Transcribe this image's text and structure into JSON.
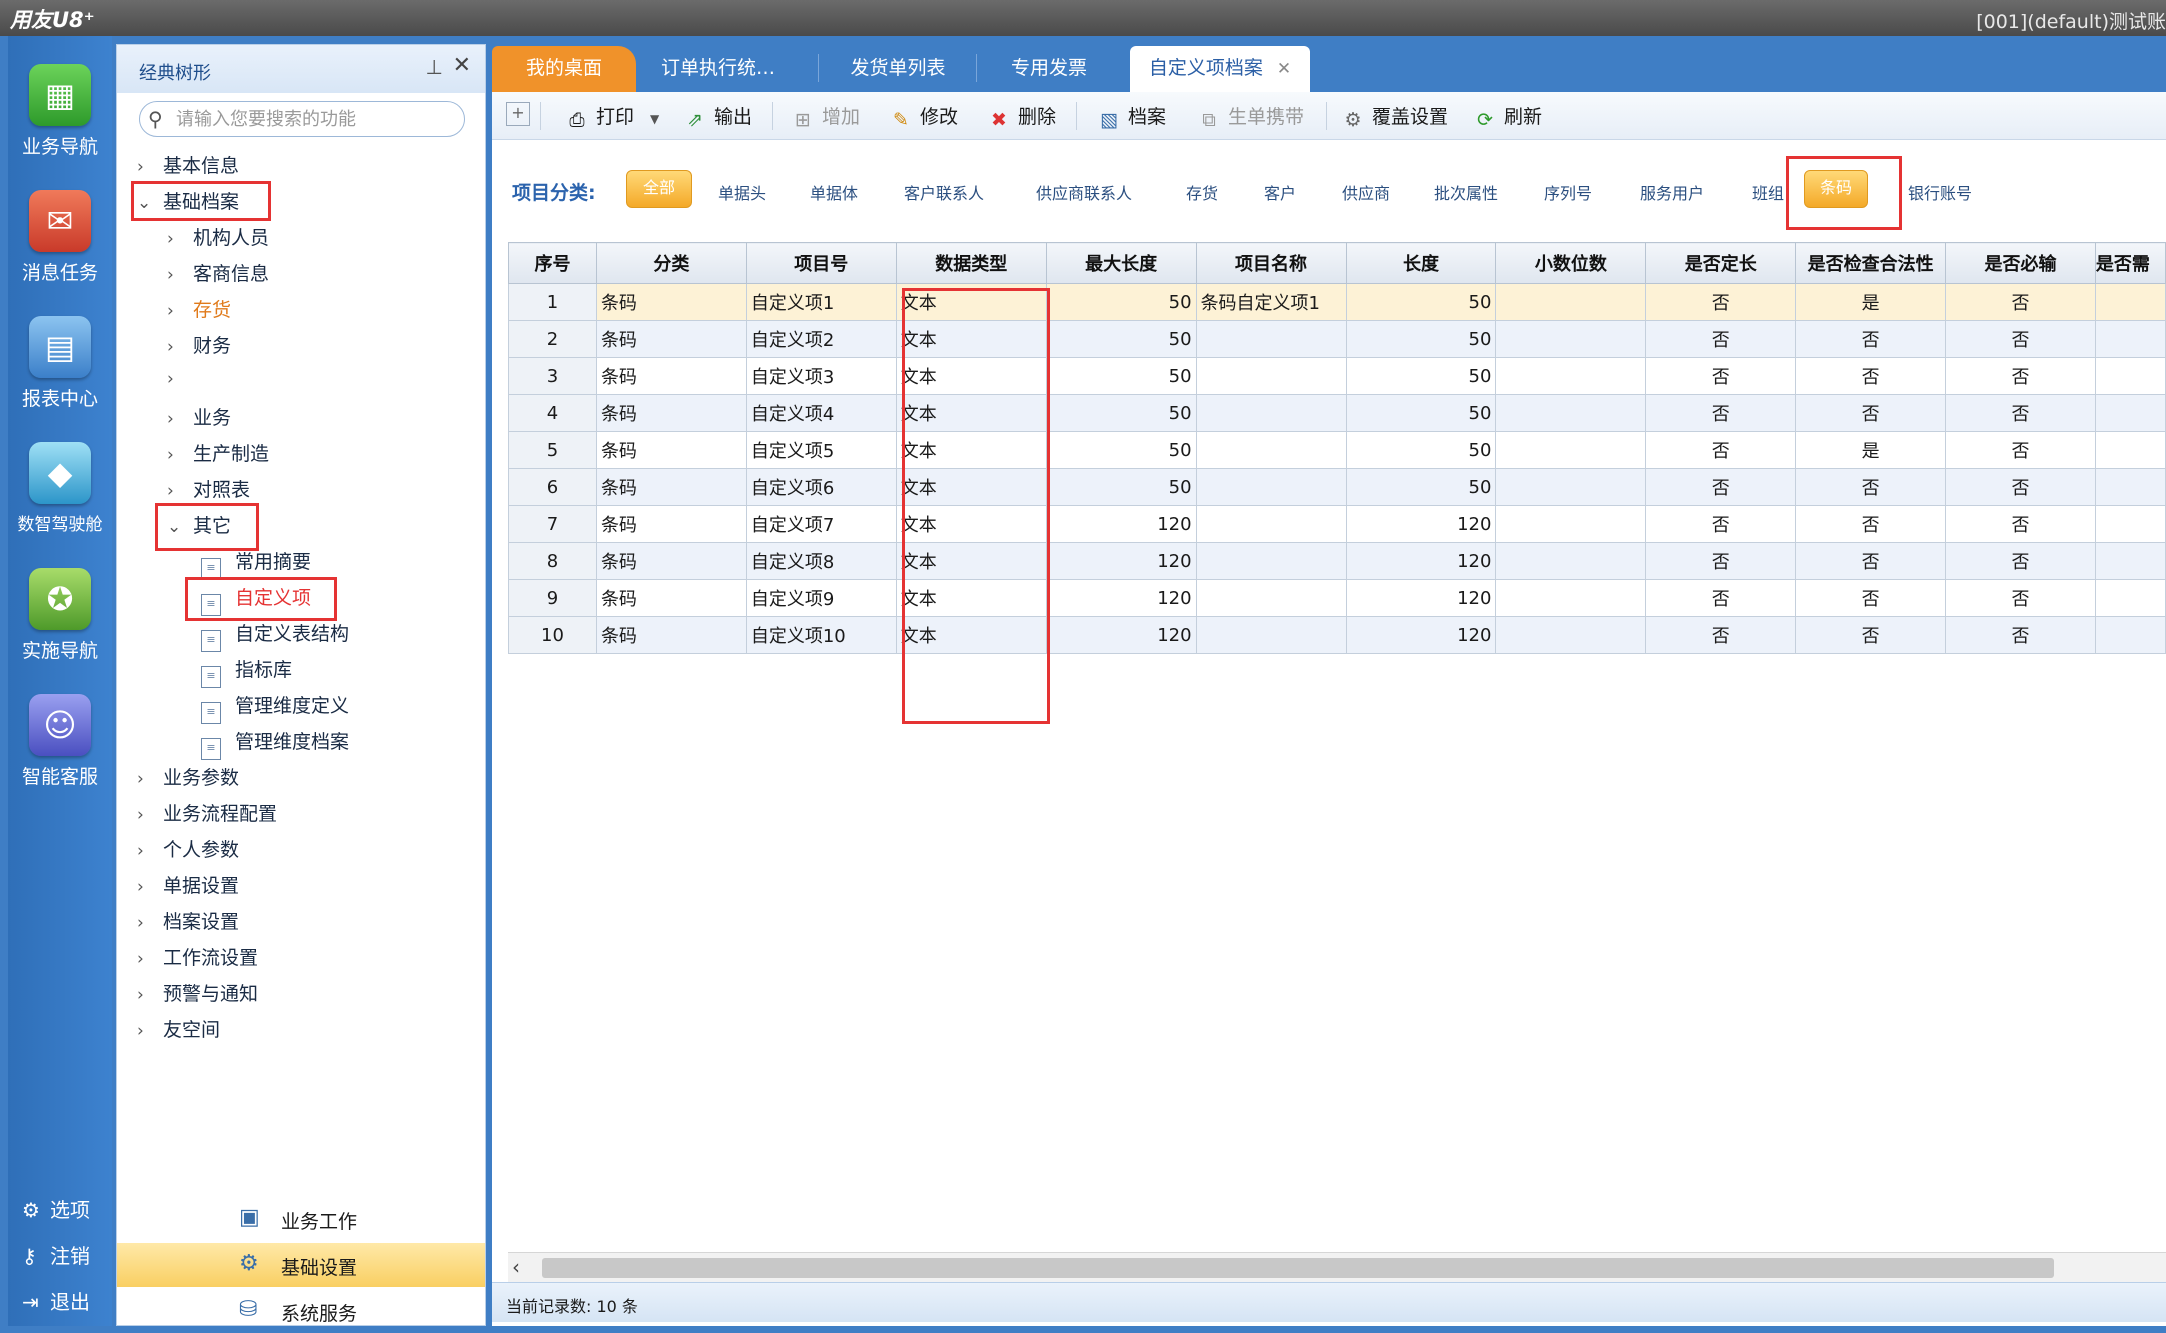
{
  "app": {
    "title": "用友U8⁺",
    "account": "[001](default)测试账"
  },
  "rail": {
    "items": [
      {
        "label": "业务导航",
        "icon": "business-nav-icon",
        "color": "#3fae3a"
      },
      {
        "label": "消息任务",
        "icon": "message-task-icon",
        "color": "#d94b3b"
      },
      {
        "label": "报表中心",
        "icon": "report-center-icon",
        "color": "#3b8fd9"
      },
      {
        "label": "数智驾驶舱",
        "icon": "cockpit-icon",
        "color": "#3aa6d4"
      },
      {
        "label": "实施导航",
        "icon": "implement-nav-icon",
        "color": "#6bb43a"
      },
      {
        "label": "智能客服",
        "icon": "smart-service-icon",
        "color": "#5a5fd0"
      }
    ],
    "bottom": [
      {
        "label": "选项",
        "icon": "gear-icon"
      },
      {
        "label": "注销",
        "icon": "key-icon"
      },
      {
        "label": "退出",
        "icon": "exit-icon"
      }
    ]
  },
  "tree": {
    "title": "经典树形",
    "search_placeholder": "请输入您要搜索的功能",
    "nodes": [
      {
        "label": "基本信息",
        "state": "collapsed"
      },
      {
        "label": "基础档案",
        "state": "expanded"
      },
      {
        "label": "机构人员",
        "state": "collapsed"
      },
      {
        "label": "客商信息",
        "state": "collapsed"
      },
      {
        "label": "存货",
        "state": "collapsed"
      },
      {
        "label": "财务",
        "state": "collapsed"
      },
      {
        "label": "",
        "state": "collapsed"
      },
      {
        "label": "业务",
        "state": "collapsed"
      },
      {
        "label": "生产制造",
        "state": "collapsed"
      },
      {
        "label": "对照表",
        "state": "collapsed"
      },
      {
        "label": "其它",
        "state": "expanded"
      },
      {
        "label": "常用摘要",
        "state": "leaf"
      },
      {
        "label": "自定义项",
        "state": "leaf"
      },
      {
        "label": "自定义表结构",
        "state": "leaf"
      },
      {
        "label": "指标库",
        "state": "leaf"
      },
      {
        "label": "管理维度定义",
        "state": "leaf"
      },
      {
        "label": "管理维度档案",
        "state": "leaf"
      },
      {
        "label": "业务参数",
        "state": "collapsed"
      },
      {
        "label": "业务流程配置",
        "state": "collapsed"
      },
      {
        "label": "个人参数",
        "state": "collapsed"
      },
      {
        "label": "单据设置",
        "state": "collapsed"
      },
      {
        "label": "档案设置",
        "state": "collapsed"
      },
      {
        "label": "工作流设置",
        "state": "collapsed"
      },
      {
        "label": "预警与通知",
        "state": "collapsed"
      },
      {
        "label": "友空间",
        "state": "collapsed"
      }
    ],
    "switcher": [
      {
        "label": "业务工作"
      },
      {
        "label": "基础设置"
      },
      {
        "label": "系统服务"
      }
    ]
  },
  "tabs": [
    "我的桌面",
    "订单执行统…",
    "发货单列表",
    "专用发票",
    "自定义项档案"
  ],
  "toolbar": [
    "打印",
    "输出",
    "增加",
    "修改",
    "删除",
    "档案",
    "生单携带",
    "覆盖设置",
    "刷新"
  ],
  "categories": {
    "label": "项目分类:",
    "items": [
      "全部",
      "单据头",
      "单据体",
      "客户联系人",
      "供应商联系人",
      "存货",
      "客户",
      "供应商",
      "批次属性",
      "序列号",
      "服务用户",
      "班组",
      "条码",
      "银行账号"
    ]
  },
  "grid": {
    "columns": [
      "序号",
      "分类",
      "项目号",
      "数据类型",
      "最大长度",
      "项目名称",
      "长度",
      "小数位数",
      "是否定长",
      "是否检查合法性",
      "是否必输",
      "是否需"
    ],
    "rows": [
      [
        "1",
        "条码",
        "自定义项1",
        "文本",
        "50",
        "条码自定义项1",
        "50",
        "",
        "否",
        "是",
        "否",
        ""
      ],
      [
        "2",
        "条码",
        "自定义项2",
        "文本",
        "50",
        "",
        "50",
        "",
        "否",
        "否",
        "否",
        ""
      ],
      [
        "3",
        "条码",
        "自定义项3",
        "文本",
        "50",
        "",
        "50",
        "",
        "否",
        "否",
        "否",
        ""
      ],
      [
        "4",
        "条码",
        "自定义项4",
        "文本",
        "50",
        "",
        "50",
        "",
        "否",
        "否",
        "否",
        ""
      ],
      [
        "5",
        "条码",
        "自定义项5",
        "文本",
        "50",
        "",
        "50",
        "",
        "否",
        "是",
        "否",
        ""
      ],
      [
        "6",
        "条码",
        "自定义项6",
        "文本",
        "50",
        "",
        "50",
        "",
        "否",
        "否",
        "否",
        ""
      ],
      [
        "7",
        "条码",
        "自定义项7",
        "文本",
        "120",
        "",
        "120",
        "",
        "否",
        "否",
        "否",
        ""
      ],
      [
        "8",
        "条码",
        "自定义项8",
        "文本",
        "120",
        "",
        "120",
        "",
        "否",
        "否",
        "否",
        ""
      ],
      [
        "9",
        "条码",
        "自定义项9",
        "文本",
        "120",
        "",
        "120",
        "",
        "否",
        "否",
        "否",
        ""
      ],
      [
        "10",
        "条码",
        "自定义项10",
        "文本",
        "120",
        "",
        "120",
        "",
        "否",
        "否",
        "否",
        ""
      ]
    ]
  },
  "status": {
    "text": "当前记录数:  10 条"
  },
  "colors": {
    "accent": "#3f7ec5",
    "highlight": "#e53333",
    "active_tab": "#f0922a",
    "selected_category": "#f4a928"
  }
}
